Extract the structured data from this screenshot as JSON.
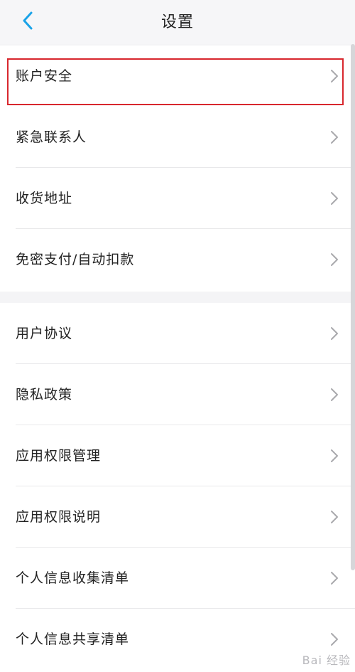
{
  "header": {
    "back_icon": "chevron-left-icon",
    "title": "设置",
    "accent": "#1aa3e8"
  },
  "groups": [
    {
      "items": [
        {
          "label": "账户安全",
          "highlighted": true
        },
        {
          "label": "紧急联系人"
        },
        {
          "label": "收货地址"
        },
        {
          "label": "免密支付/自动扣款"
        }
      ]
    },
    {
      "items": [
        {
          "label": "用户协议"
        },
        {
          "label": "隐私政策"
        },
        {
          "label": "应用权限管理"
        },
        {
          "label": "应用权限说明"
        },
        {
          "label": "个人信息收集清单"
        },
        {
          "label": "个人信息共享清单"
        }
      ]
    }
  ],
  "watermark": "Bai 经验",
  "highlight_color": "#d8272d"
}
